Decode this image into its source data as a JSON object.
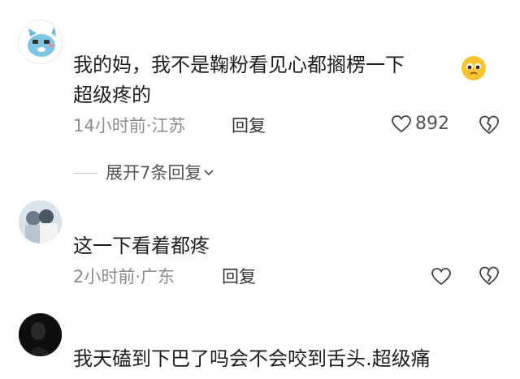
{
  "comments": [
    {
      "text_line1": "我的妈，我不是鞠粉看见心都搁楞一下",
      "text_line2": "超级疼的",
      "meta": "14小时前·江苏",
      "reply_label": "回复",
      "likes": "892",
      "expand_label": "展开7条回复"
    },
    {
      "text_line1": "这一下看着都疼",
      "meta": "2小时前·广东",
      "reply_label": "回复"
    },
    {
      "text_line1": "我天磕到下巴了吗会不会咬到舌头.超级痛"
    }
  ]
}
